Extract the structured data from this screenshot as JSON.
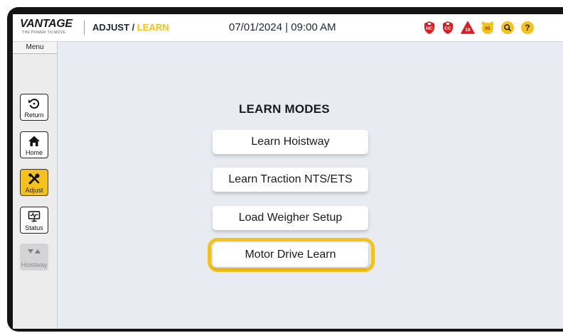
{
  "header": {
    "brand": "VANTAGE",
    "brand_tagline": "THE POWER TO MOVE",
    "breadcrumb_section": "ADJUST",
    "breadcrumb_separator": " / ",
    "breadcrumb_page": "LEARN",
    "datetime": "07/01/2024 | 09:00 AM",
    "status_icons": [
      {
        "name": "hc-shield-icon",
        "label": "HC",
        "color": "#d81f26"
      },
      {
        "name": "cc-shield-icon",
        "label": "CC",
        "color": "#d81f26"
      },
      {
        "name": "alarm-triangle-icon",
        "label": "10",
        "color": "#d81f26"
      },
      {
        "name": "event-gear-icon",
        "label": "05",
        "color": "#f5c21b"
      },
      {
        "name": "search-icon",
        "label": "",
        "color": "#f5c21b"
      },
      {
        "name": "help-icon",
        "label": "?",
        "color": "#f5c21b"
      }
    ]
  },
  "sidebar": {
    "menu_label": "Menu",
    "items": [
      {
        "label": "Return",
        "icon": "return-icon"
      },
      {
        "label": "Home",
        "icon": "home-icon"
      },
      {
        "label": "Adjust",
        "icon": "tools-icon"
      },
      {
        "label": "Status",
        "icon": "monitor-icon"
      },
      {
        "label": "Hoistway",
        "icon": "hoistway-arrows-icon"
      }
    ]
  },
  "main": {
    "title": "LEARN MODES",
    "buttons": [
      {
        "label": "Learn Hoistway"
      },
      {
        "label": "Learn Traction NTS/ETS"
      },
      {
        "label": "Load Weigher Setup"
      },
      {
        "label": "Motor Drive Learn",
        "highlighted": true
      }
    ]
  },
  "colors": {
    "accent": "#f5c21b",
    "alert": "#d81f26",
    "background": "#e8ebf1"
  }
}
